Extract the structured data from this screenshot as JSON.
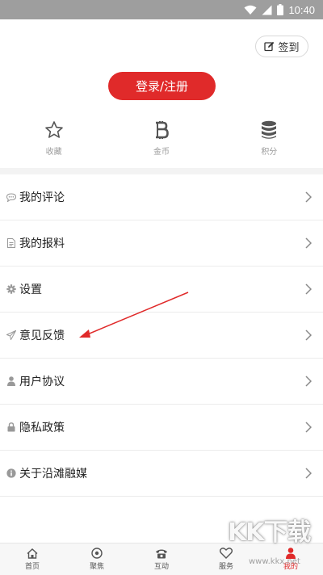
{
  "status_bar": {
    "time": "10:40",
    "icons": [
      "wifi-icon",
      "signal-icon",
      "battery-icon"
    ]
  },
  "header": {
    "sign_in_label": "签到",
    "sign_in_icon": "edit-icon",
    "login_label": "登录/注册"
  },
  "quick_items": [
    {
      "label": "收藏",
      "icon": "star-icon"
    },
    {
      "label": "金币",
      "icon": "bitcoin-icon"
    },
    {
      "label": "积分",
      "icon": "database-icon"
    }
  ],
  "menu": [
    {
      "label": "我的评论",
      "icon": "comment-icon"
    },
    {
      "label": "我的报料",
      "icon": "document-icon"
    },
    {
      "label": "设置",
      "icon": "gear-icon"
    },
    {
      "label": "意见反馈",
      "icon": "paper-plane-icon"
    },
    {
      "label": "用户协议",
      "icon": "user-icon"
    },
    {
      "label": "隐私政策",
      "icon": "lock-icon"
    },
    {
      "label": "关于沿滩融媒",
      "icon": "info-icon"
    }
  ],
  "tabs": [
    {
      "label": "首页",
      "icon": "home-icon"
    },
    {
      "label": "聚焦",
      "icon": "focus-icon"
    },
    {
      "label": "互动",
      "icon": "phone-icon"
    },
    {
      "label": "服务",
      "icon": "heart-icon"
    },
    {
      "label": "我的",
      "icon": "person-icon",
      "active": true
    }
  ],
  "watermark": {
    "text": "KK下载",
    "url": "www.kkx.net"
  },
  "colors": {
    "accent": "#e02a2a",
    "status_bar": "#9e9e9e",
    "divider": "#f3f3f3"
  }
}
